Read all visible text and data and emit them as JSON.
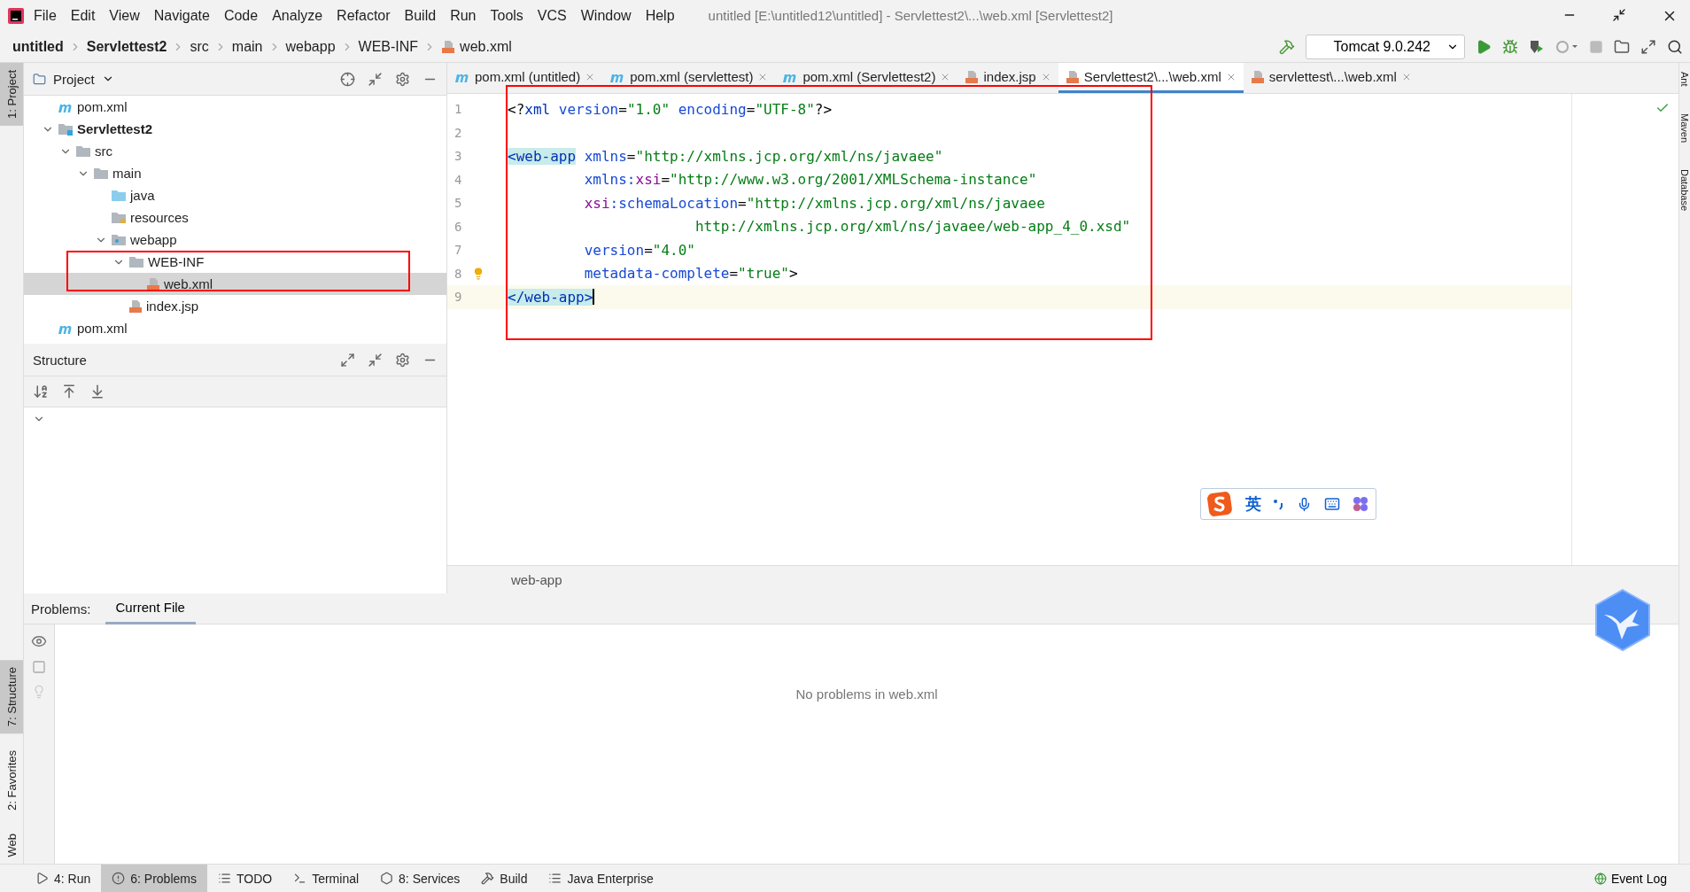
{
  "window": {
    "title": "untitled [E:\\untitled12\\untitled] - Servlettest2\\...\\web.xml [Servlettest2]"
  },
  "menu": [
    "File",
    "Edit",
    "View",
    "Navigate",
    "Code",
    "Analyze",
    "Refactor",
    "Build",
    "Run",
    "Tools",
    "VCS",
    "Window",
    "Help"
  ],
  "breadcrumb": [
    {
      "label": "untitled",
      "bold": true
    },
    {
      "label": "Servlettest2",
      "bold": true
    },
    {
      "label": "src",
      "bold": false
    },
    {
      "label": "main",
      "bold": false
    },
    {
      "label": "webapp",
      "bold": false
    },
    {
      "label": "WEB-INF",
      "bold": false
    },
    {
      "label": "web.xml",
      "bold": false,
      "kind": "xml"
    }
  ],
  "run_config": "Tomcat 9.0.242",
  "left_stripe": [
    {
      "label": "1: Project",
      "selected": true
    },
    {
      "label": "7: Structure",
      "selected": true
    },
    {
      "label": "2: Favorites",
      "selected": false
    },
    {
      "label": "Web",
      "selected": false
    }
  ],
  "right_stripe": [
    "Ant",
    "Maven",
    "Database"
  ],
  "project_panel": {
    "title": "Project",
    "tree": [
      {
        "label": "pom.xml",
        "kind": "maven",
        "selected": false
      },
      {
        "label": "Servlettest2",
        "kind": "module",
        "bold": true,
        "expanded": true,
        "selected": false,
        "children": [
          {
            "label": "src",
            "kind": "folder",
            "expanded": true,
            "selected": false,
            "children": [
              {
                "label": "main",
                "kind": "folder",
                "expanded": true,
                "selected": false,
                "children": [
                  {
                    "label": "java",
                    "kind": "source",
                    "selected": false
                  },
                  {
                    "label": "resources",
                    "kind": "resources",
                    "selected": false
                  },
                  {
                    "label": "webapp",
                    "kind": "web",
                    "expanded": true,
                    "selected": false,
                    "children": [
                      {
                        "label": "WEB-INF",
                        "kind": "folder",
                        "expanded": true,
                        "selected": false,
                        "children": [
                          {
                            "label": "web.xml",
                            "kind": "xml",
                            "selected": true
                          }
                        ]
                      },
                      {
                        "label": "index.jsp",
                        "kind": "jsp",
                        "selected": false
                      }
                    ]
                  }
                ]
              }
            ]
          }
        ]
      },
      {
        "label": "pom.xml",
        "kind": "maven",
        "selected": false
      }
    ]
  },
  "structure_panel": {
    "title": "Structure"
  },
  "editor": {
    "tabs": [
      {
        "label": "pom.xml (untitled)",
        "kind": "maven",
        "selected": false
      },
      {
        "label": "pom.xml (servlettest)",
        "kind": "maven",
        "selected": false
      },
      {
        "label": "pom.xml (Servlettest2)",
        "kind": "maven",
        "selected": false
      },
      {
        "label": "index.jsp",
        "kind": "jsp",
        "selected": false
      },
      {
        "label": "Servlettest2\\...\\web.xml",
        "kind": "xml",
        "selected": true
      },
      {
        "label": "servlettest\\...\\web.xml",
        "kind": "xml",
        "selected": false
      }
    ],
    "lines": [
      {
        "number": "1",
        "current": false,
        "tokens": [
          {
            "kind": "text",
            "text": "<?"
          },
          {
            "kind": "keyword",
            "text": "xml "
          },
          {
            "kind": "attr",
            "text": "version"
          },
          {
            "kind": "text",
            "text": "="
          },
          {
            "kind": "value",
            "text": "\"1.0\" "
          },
          {
            "kind": "attr",
            "text": "encoding"
          },
          {
            "kind": "text",
            "text": "="
          },
          {
            "kind": "value",
            "text": "\"UTF-8\""
          },
          {
            "kind": "text",
            "text": "?>"
          }
        ]
      },
      {
        "number": "2",
        "current": false
      },
      {
        "number": "3",
        "current": false,
        "tokens": [
          {
            "kind": "tag",
            "text": "<web-app",
            "matched": true
          },
          {
            "kind": "attr",
            "text": " xmlns"
          },
          {
            "kind": "text",
            "text": "="
          },
          {
            "kind": "value",
            "text": "\"http://xmlns.jcp.org/xml/ns/javaee\""
          }
        ]
      },
      {
        "number": "4",
        "current": false,
        "tokens": [
          {
            "kind": "attr",
            "text": "         xmlns:"
          },
          {
            "kind": "ns",
            "text": "xsi"
          },
          {
            "kind": "text",
            "text": "="
          },
          {
            "kind": "value",
            "text": "\"http://www.w3.org/2001/XMLSchema-instance\""
          }
        ]
      },
      {
        "number": "5",
        "current": false,
        "tokens": [
          {
            "kind": "ns",
            "text": "         xsi"
          },
          {
            "kind": "attr",
            "text": ":schemaLocation"
          },
          {
            "kind": "text",
            "text": "="
          },
          {
            "kind": "value",
            "text": "\"http://xmlns.jcp.org/xml/ns/javaee"
          }
        ]
      },
      {
        "number": "6",
        "current": false,
        "tokens": [
          {
            "kind": "value",
            "text": "                      http://xmlns.jcp.org/xml/ns/javaee/web-app_4_0.xsd\""
          }
        ]
      },
      {
        "number": "7",
        "current": false,
        "tokens": [
          {
            "kind": "attr",
            "text": "         version"
          },
          {
            "kind": "text",
            "text": "="
          },
          {
            "kind": "value",
            "text": "\"4.0\""
          }
        ]
      },
      {
        "number": "8",
        "current": false,
        "bulb": true,
        "tokens": [
          {
            "kind": "attr",
            "text": "         metadata-complete"
          },
          {
            "kind": "text",
            "text": "="
          },
          {
            "kind": "value",
            "text": "\"true\""
          },
          {
            "kind": "text",
            "text": ">"
          }
        ]
      },
      {
        "number": "9",
        "current": true,
        "tokens": [
          {
            "kind": "tag",
            "text": "</web-app>",
            "matched": true
          }
        ]
      }
    ],
    "path": "web-app"
  },
  "ime_toolbar": {
    "mode": "英"
  },
  "problems": {
    "label": "Problems:",
    "tabs": [
      {
        "label": "Current File",
        "selected": true
      }
    ],
    "message": "No problems in web.xml"
  },
  "bottom_tools": [
    {
      "label": "4: Run",
      "kind": "run",
      "selected": false
    },
    {
      "label": "6: Problems",
      "kind": "problems",
      "selected": true
    },
    {
      "label": "TODO",
      "kind": "todo",
      "selected": false
    },
    {
      "label": "Terminal",
      "kind": "terminal",
      "selected": false
    },
    {
      "label": "8: Services",
      "kind": "services",
      "selected": false
    },
    {
      "label": "Build",
      "kind": "build",
      "selected": false
    },
    {
      "label": "Java Enterprise",
      "kind": "enterprise",
      "selected": false
    }
  ],
  "event_log": "Event Log"
}
